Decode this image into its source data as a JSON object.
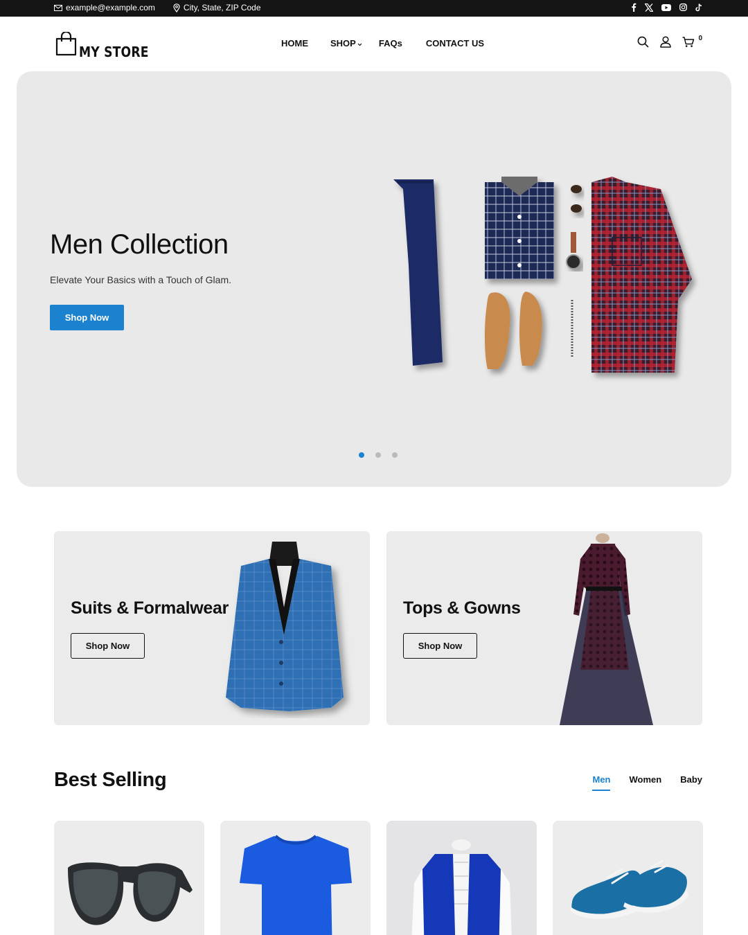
{
  "topbar": {
    "email": "example@example.com",
    "address": "City, State, ZIP Code",
    "social": [
      "facebook-icon",
      "x-icon",
      "youtube-icon",
      "instagram-icon",
      "tiktok-icon"
    ]
  },
  "header": {
    "logo_text": "MY STORE",
    "nav": {
      "home": "HOME",
      "shop": "SHOP",
      "faqs": "FAQs",
      "contact": "CONTACT US"
    },
    "cart_count": "0"
  },
  "hero": {
    "title": "Men Collection",
    "subtitle": "Elevate Your Basics with a Touch of Glam.",
    "button": "Shop Now",
    "slides": 3,
    "active_slide": 1
  },
  "categories": [
    {
      "title": "Suits & Formalwear",
      "button": "Shop Now"
    },
    {
      "title": "Tops & Gowns",
      "button": "Shop Now"
    }
  ],
  "best_selling": {
    "title": "Best Selling",
    "tabs": [
      "Men",
      "Women",
      "Baby"
    ],
    "active_tab": "Men"
  },
  "colors": {
    "accent": "#1a82cf",
    "topbar": "#141414",
    "panel": "#e9e9e9"
  }
}
